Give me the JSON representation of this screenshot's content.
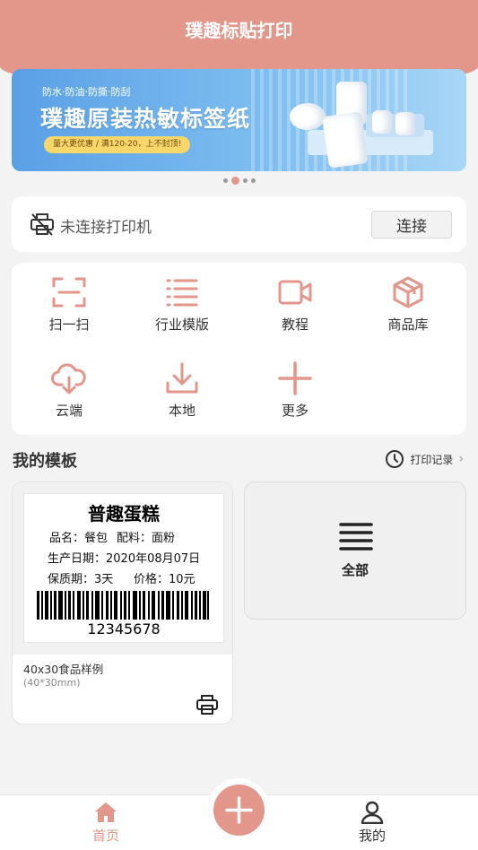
{
  "app": {
    "title": "璞趣标贴打印"
  },
  "banner": {
    "subtitle": "防水·防油·防撕·防刮",
    "title": "璞趣原装热敏标签纸",
    "promo": "量大更优惠 / 满120-20，上不封顶!",
    "slide_count": 4,
    "active_slide": 2
  },
  "printer": {
    "status_text": "未连接打印机",
    "connect_label": "连接",
    "icon": "printer-disconnected-icon"
  },
  "menu": {
    "items": [
      {
        "label": "扫一扫",
        "icon": "scan-icon"
      },
      {
        "label": "行业模版",
        "icon": "list-icon"
      },
      {
        "label": "教程",
        "icon": "video-icon"
      },
      {
        "label": "商品库",
        "icon": "box-icon"
      },
      {
        "label": "云端",
        "icon": "cloud-download-icon"
      },
      {
        "label": "本地",
        "icon": "download-icon"
      },
      {
        "label": "更多",
        "icon": "plus-icon"
      }
    ]
  },
  "templates": {
    "section_title": "我的模板",
    "history_label": "打印记录",
    "items": [
      {
        "name": "40x30食品样例",
        "size": "(40*30mm)",
        "preview": {
          "title": "普趣蛋糕",
          "line1_a": "品名：餐包",
          "line1_b": "配料：面粉",
          "line2": "生产日期：2020年08月07日",
          "line3_a": "保质期：3天",
          "line3_b": "价格：10元",
          "barcode": "12345678"
        }
      }
    ],
    "all_label": "全部"
  },
  "nav": {
    "home_label": "首页",
    "mine_label": "我的",
    "active": "home"
  },
  "colors": {
    "accent": "#e3968a",
    "background": "#f3f3f3"
  }
}
